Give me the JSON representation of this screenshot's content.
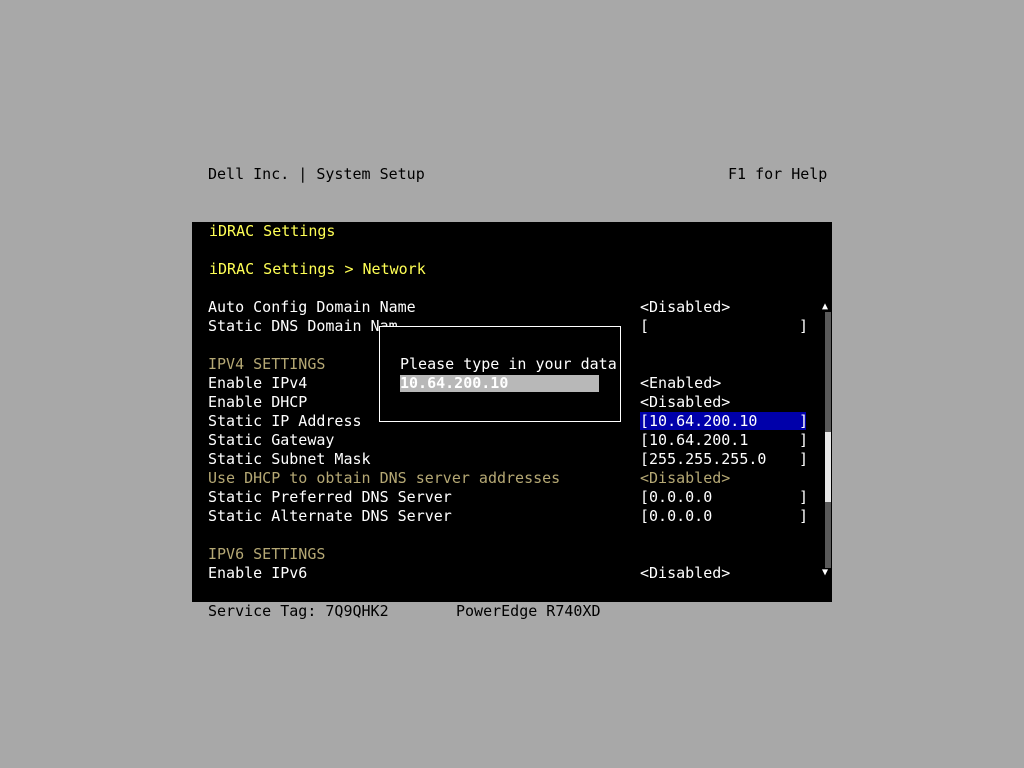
{
  "header": {
    "title": "Dell Inc. | System Setup",
    "help": "F1 for Help"
  },
  "panel": {
    "title": "iDRAC Settings",
    "breadcrumb": "iDRAC Settings > Network"
  },
  "settings": {
    "auto_config_domain_name": {
      "label": "Auto Config Domain Name",
      "value": "<Disabled>"
    },
    "static_dns_domain_name": {
      "label": "Static DNS Domain Nam",
      "value": "[",
      "close": "]"
    },
    "ipv4_header": "IPV4 SETTINGS",
    "enable_ipv4": {
      "label": "Enable IPv4",
      "value": "<Enabled>"
    },
    "enable_dhcp": {
      "label": "Enable DHCP",
      "value": "<Disabled>"
    },
    "static_ip": {
      "label": "Static IP Address",
      "value": "[10.64.200.10",
      "close": "]"
    },
    "static_gateway": {
      "label": "Static Gateway",
      "value": "[10.64.200.1",
      "close": "]"
    },
    "static_subnet": {
      "label": "Static Subnet Mask",
      "value": "[255.255.255.0",
      "close": "]"
    },
    "use_dhcp_dns": {
      "label": "Use DHCP to obtain DNS server addresses",
      "value": "<Disabled>"
    },
    "preferred_dns": {
      "label": "Static Preferred DNS Server",
      "value": "[0.0.0.0",
      "close": "]"
    },
    "alternate_dns": {
      "label": "Static Alternate DNS Server",
      "value": "[0.0.0.0",
      "close": "]"
    },
    "ipv6_header": "IPV6 SETTINGS",
    "enable_ipv6": {
      "label": "Enable IPv6",
      "value": "<Disabled>"
    }
  },
  "dialog": {
    "title": "Please type in your data",
    "input_value": "10.64.200.10"
  },
  "footer": {
    "service_tag": "Service Tag: 7Q9QHK2",
    "model": "PowerEdge R740XD"
  },
  "colors": {
    "background": "#a8a8a8",
    "panel": "#000000",
    "highlight": "#0000aa",
    "title_yellow": "#ffff55",
    "disabled_olive": "#b5a874"
  },
  "icons": {
    "scroll_up": "up-arrow-icon",
    "scroll_down": "down-arrow-icon"
  }
}
